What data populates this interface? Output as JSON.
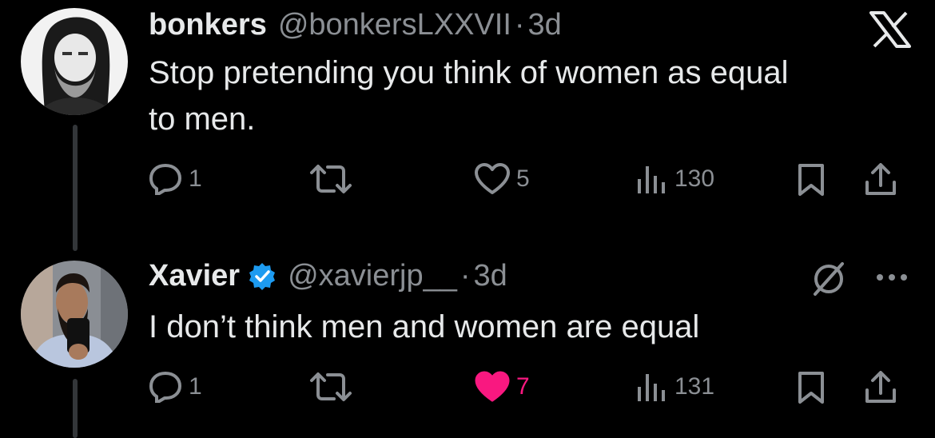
{
  "tweets": [
    {
      "name": "bonkers",
      "handle": "@bonkersLXXVII",
      "separator": "·",
      "time": "3d",
      "text_line1": "Stop pretending you think of women as equal",
      "text_line2": "to men.",
      "replies": "1",
      "likes": "5",
      "views": "130",
      "liked": false,
      "avatar_icon": "avatar-man-long-hair"
    },
    {
      "name": "Xavier",
      "handle": "@xavierjp__",
      "separator": "·",
      "time": "3d",
      "text_line1": "I don’t think men and women are equal",
      "replies": "1",
      "likes": "7",
      "views": "131",
      "liked": true,
      "verified": true,
      "avatar_icon": "avatar-man-selfie"
    }
  ],
  "colors": {
    "background": "#000000",
    "text": "#e7e9ea",
    "muted": "#8b8f94",
    "like": "#f91880",
    "verified": "#1d9bf0"
  },
  "icons": {
    "top_right": "x-logo-icon",
    "grok": "grok-icon",
    "more": "more-icon"
  }
}
